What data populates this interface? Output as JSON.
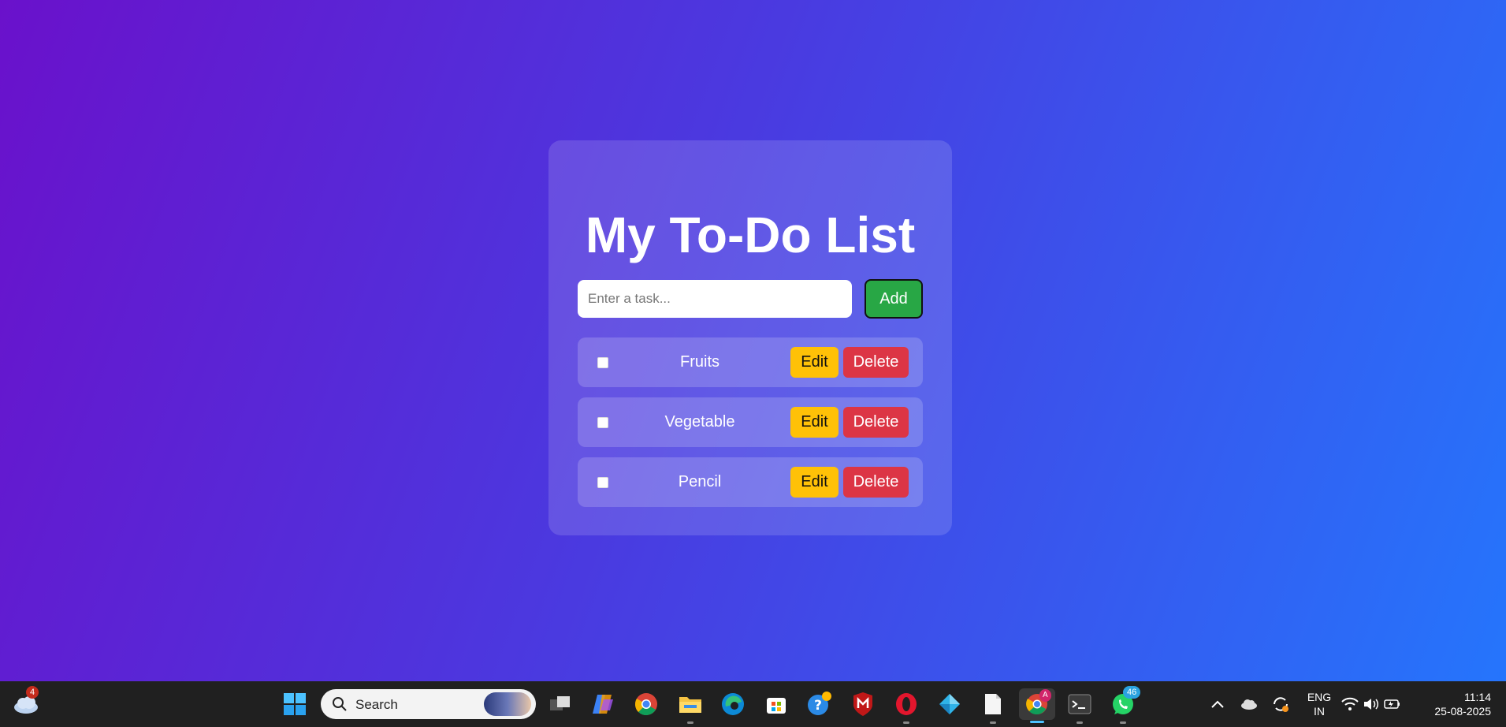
{
  "app": {
    "title": "My To-Do List",
    "input_placeholder": "Enter a task...",
    "add_label": "Add",
    "tasks": [
      {
        "label": "Fruits",
        "checked": false,
        "edit_label": "Edit",
        "delete_label": "Delete"
      },
      {
        "label": "Vegetable",
        "checked": false,
        "edit_label": "Edit",
        "delete_label": "Delete"
      },
      {
        "label": "Pencil",
        "checked": false,
        "edit_label": "Edit",
        "delete_label": "Delete"
      }
    ],
    "colors": {
      "background_start": "#6a11cb",
      "background_end": "#2575fc",
      "add_button": "#28a745",
      "edit_button": "#ffc107",
      "delete_button": "#dc3545"
    }
  },
  "taskbar": {
    "weather_badge": "4",
    "search_label": "Search",
    "whatsapp_badge": "46",
    "chrome_profile_badge": "A",
    "language": "ENG",
    "region": "IN",
    "time": "11:14",
    "date": "25-08-2025",
    "pinned_icons": [
      "task-view-icon",
      "copilot-icon",
      "chrome-icon",
      "file-explorer-icon",
      "edge-icon",
      "microsoft-store-icon",
      "get-help-icon",
      "mcafee-icon",
      "opera-icon",
      "gem-app-icon",
      "notepad-icon",
      "chrome-profile-icon",
      "terminal-icon",
      "whatsapp-icon"
    ]
  }
}
